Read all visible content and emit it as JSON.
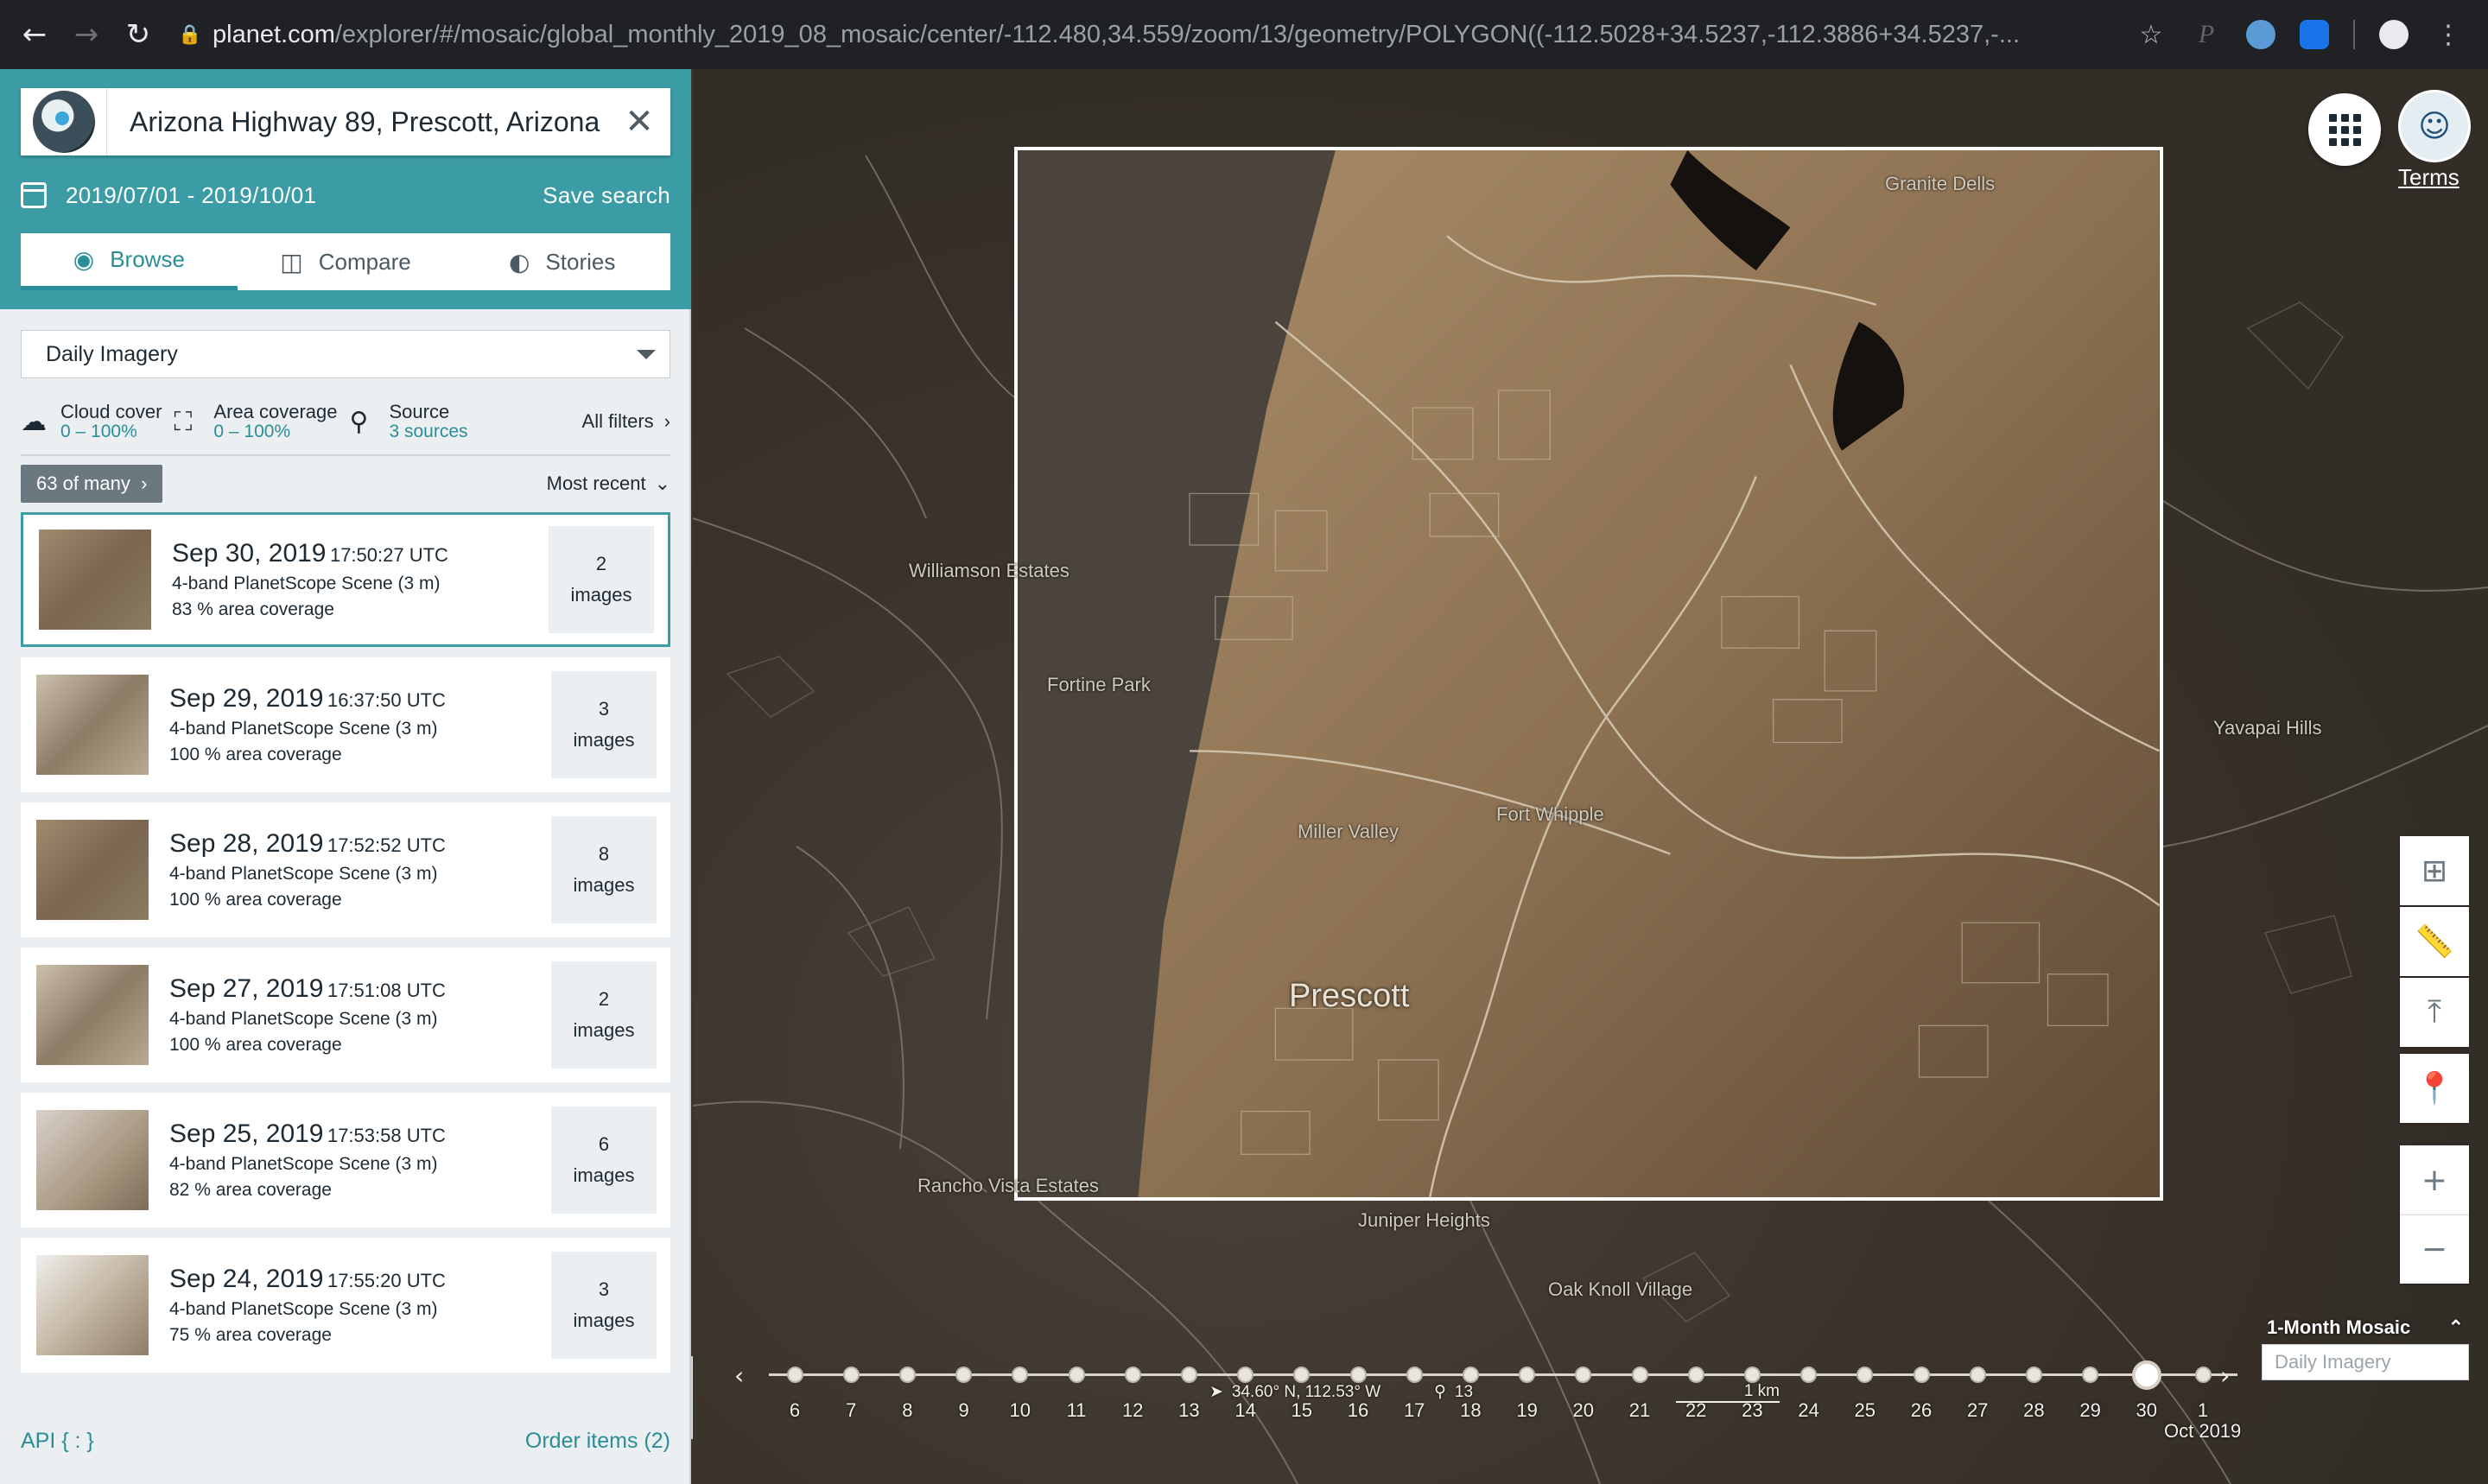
{
  "browser": {
    "url_host": "planet.com",
    "url_path": "/explorer/#/mosaic/global_monthly_2019_08_mosaic/center/-112.480,34.559/zoom/13/geometry/POLYGON((-112.5028+34.5237,-112.3886+34.5237,-..."
  },
  "sidebar": {
    "search_value": "Arizona Highway 89, Prescott, Arizona",
    "date_range": "2019/07/01 - 2019/10/01",
    "save_search": "Save search",
    "tabs": [
      {
        "label": "Browse",
        "icon": "eye-icon"
      },
      {
        "label": "Compare",
        "icon": "compare-icon"
      },
      {
        "label": "Stories",
        "icon": "stories-icon"
      }
    ],
    "imagery_type": "Daily Imagery",
    "filters": {
      "cloud": {
        "label": "Cloud cover",
        "value": "0 – 100%"
      },
      "area": {
        "label": "Area coverage",
        "value": "0 – 100%"
      },
      "source": {
        "label": "Source",
        "value": "3 sources"
      },
      "all": "All filters"
    },
    "results_count": "63 of many",
    "sort": "Most recent",
    "results": [
      {
        "date": "Sep 30, 2019",
        "time": "17:50:27 UTC",
        "scene": "4-band PlanetScope Scene (3 m)",
        "coverage": "83 % area coverage",
        "count": "2",
        "count_label": "images"
      },
      {
        "date": "Sep 29, 2019",
        "time": "16:37:50 UTC",
        "scene": "4-band PlanetScope Scene (3 m)",
        "coverage": "100 % area coverage",
        "count": "3",
        "count_label": "images"
      },
      {
        "date": "Sep 28, 2019",
        "time": "17:52:52 UTC",
        "scene": "4-band PlanetScope Scene (3 m)",
        "coverage": "100 % area coverage",
        "count": "8",
        "count_label": "images"
      },
      {
        "date": "Sep 27, 2019",
        "time": "17:51:08 UTC",
        "scene": "4-band PlanetScope Scene (3 m)",
        "coverage": "100 % area coverage",
        "count": "2",
        "count_label": "images"
      },
      {
        "date": "Sep 25, 2019",
        "time": "17:53:58 UTC",
        "scene": "4-band PlanetScope Scene (3 m)",
        "coverage": "82 % area coverage",
        "count": "6",
        "count_label": "images"
      },
      {
        "date": "Sep 24, 2019",
        "time": "17:55:20 UTC",
        "scene": "4-band PlanetScope Scene (3 m)",
        "coverage": "75 % area coverage",
        "count": "3",
        "count_label": "images"
      }
    ],
    "api_link": "API { : }",
    "order_items": "Order items (2)"
  },
  "map": {
    "city": "Prescott",
    "terms": "Terms",
    "place_labels": [
      "Granite Dells",
      "Williamson Estates",
      "Fortine Park",
      "Miller Valley",
      "Fort Whipple",
      "Yavapai Hills",
      "Rancho Vista Estates",
      "Juniper Heights",
      "Oak Knoll Village"
    ],
    "timeline": {
      "days": [
        "6",
        "7",
        "8",
        "9",
        "10",
        "11",
        "12",
        "13",
        "14",
        "15",
        "16",
        "17",
        "18",
        "19",
        "20",
        "21",
        "22",
        "23",
        "24",
        "25",
        "26",
        "27",
        "28",
        "29",
        "30",
        "1"
      ],
      "current_day": "30",
      "month_label": "Oct 2019"
    },
    "mosaic_title": "1-Month Mosaic",
    "mosaic_select": "Daily Imagery",
    "coords": "34.60° N, 112.53° W",
    "zoom_level": "13",
    "scale": "1 km"
  },
  "colors": {
    "accent": "#3c9ca5",
    "link": "#2a8e98"
  }
}
